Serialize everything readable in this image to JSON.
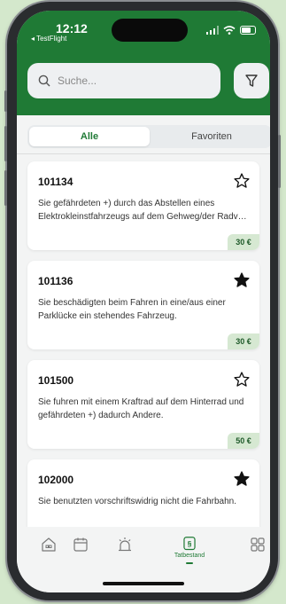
{
  "status_bar": {
    "time": "12:12",
    "back_app": "◂ TestFlight"
  },
  "search": {
    "placeholder": "Suche..."
  },
  "segments": {
    "all": "Alle",
    "favorites": "Favoriten"
  },
  "items": [
    {
      "id": "101134",
      "description": "Sie gefährdeten +) durch das Abstellen eines Elektrokleinstfahrzeugs auf dem Gehweg/der Radv…",
      "price": "30 €",
      "favorite": false
    },
    {
      "id": "101136",
      "description": "Sie beschädigten beim Fahren in eine/aus einer Parklücke ein stehendes Fahrzeug.",
      "price": "30 €",
      "favorite": true
    },
    {
      "id": "101500",
      "description": "Sie fuhren mit einem Kraftrad auf dem Hinterrad und gefährdeten +) dadurch Andere.",
      "price": "50 €",
      "favorite": false
    },
    {
      "id": "102000",
      "description": "Sie benutzten vorschriftswidrig nicht die Fahrbahn.",
      "price": "",
      "favorite": true
    }
  ],
  "tab_bar": {
    "icons": [
      "house-icon",
      "calendar-icon",
      "siren-icon",
      "paragraph-icon",
      "grid-icon"
    ],
    "active_label": "Tatbestand",
    "active_glyph": "§"
  },
  "colors": {
    "brand": "#1f7a35",
    "price_badge": "#d6e8d2"
  }
}
